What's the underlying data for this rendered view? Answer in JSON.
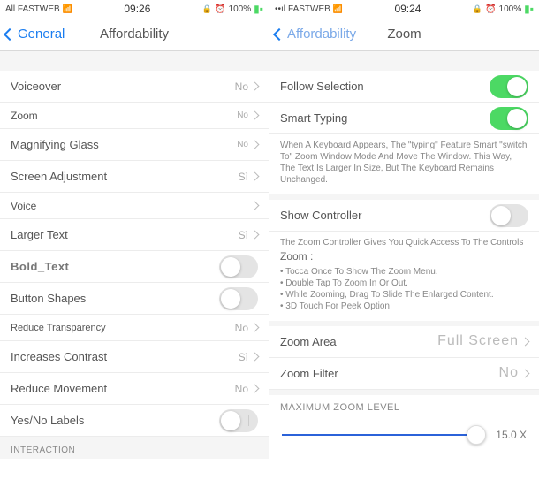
{
  "left": {
    "status": {
      "carrier": "All FASTWEB",
      "time": "09:26",
      "battery": "100%"
    },
    "nav": {
      "back": "General",
      "title": "Affordability"
    },
    "rows": {
      "voiceover": {
        "label": "Voiceover",
        "value": "No"
      },
      "zoom": {
        "label": "Zoom",
        "value": "No"
      },
      "magnifier": {
        "label": "Magnifying Glass",
        "value": "No"
      },
      "screenAdj": {
        "label": "Screen Adjustment",
        "value": "Sì"
      },
      "voice": {
        "label": "Voice"
      },
      "largerText": {
        "label": "Larger Text",
        "value": "Sì"
      },
      "boldText": {
        "label": "Bold_Text"
      },
      "buttonShapes": {
        "label": "Button Shapes"
      },
      "reduceTransparency": {
        "label": "Reduce Transparency",
        "value": "No"
      },
      "increasesContrast": {
        "label": "Increases Contrast",
        "value": "Sì"
      },
      "reduceMovement": {
        "label": "Reduce Movement",
        "value": "No"
      },
      "yesNoLabels": {
        "label": "Yes/No Labels"
      }
    },
    "interactionHeader": "INTERACTION"
  },
  "right": {
    "status": {
      "carrier": "FASTWEB",
      "time": "09:24",
      "battery": "100%"
    },
    "nav": {
      "back": "Affordability",
      "title": "Zoom"
    },
    "rows": {
      "followSelection": {
        "label": "Follow Selection"
      },
      "smartTyping": {
        "label": "Smart Typing"
      },
      "smartTypingHint": "When A Keyboard Appears, The \"typing\" Feature Smart \"switch To\" Zoom Window Mode And Move The Window. This Way, The Text Is Larger In Size, But The Keyboard Remains Unchanged.",
      "showController": {
        "label": "Show Controller"
      },
      "controllerHint": {
        "line1": "The Zoom Controller Gives You Quick Access To The Controls",
        "zoomTitle": "Zoom :",
        "b1": "• Tocca Once To Show The Zoom Menu.",
        "b2": "• Double Tap To Zoom In Or Out.",
        "b3": "• While Zooming, Drag To Slide The Enlarged Content.",
        "b4": "• 3D Touch For Peek Option"
      },
      "zoomArea": {
        "label": "Zoom Area",
        "value": "Full Screen"
      },
      "zoomFilter": {
        "label": "Zoom Filter",
        "value": "No"
      },
      "maxZoomHeader": "MAXIMUM ZOOM LEVEL",
      "maxZoomValue": "15.0 X"
    }
  }
}
